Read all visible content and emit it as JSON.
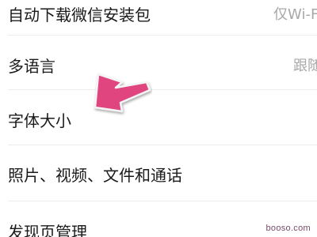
{
  "settings": {
    "items": [
      {
        "label": "自动下载微信安装包",
        "value": "仅Wi-Fi"
      },
      {
        "label": "多语言",
        "value": "跟随"
      },
      {
        "label": "字体大小",
        "value": ""
      },
      {
        "label": "照片、视频、文件和通话",
        "value": ""
      },
      {
        "label": "发现页管理",
        "value": ""
      }
    ]
  },
  "annotation": {
    "arrow_icon": "pointer-arrow-icon",
    "arrow_color": "#e0457f"
  },
  "watermark": {
    "text": "booso.com"
  }
}
